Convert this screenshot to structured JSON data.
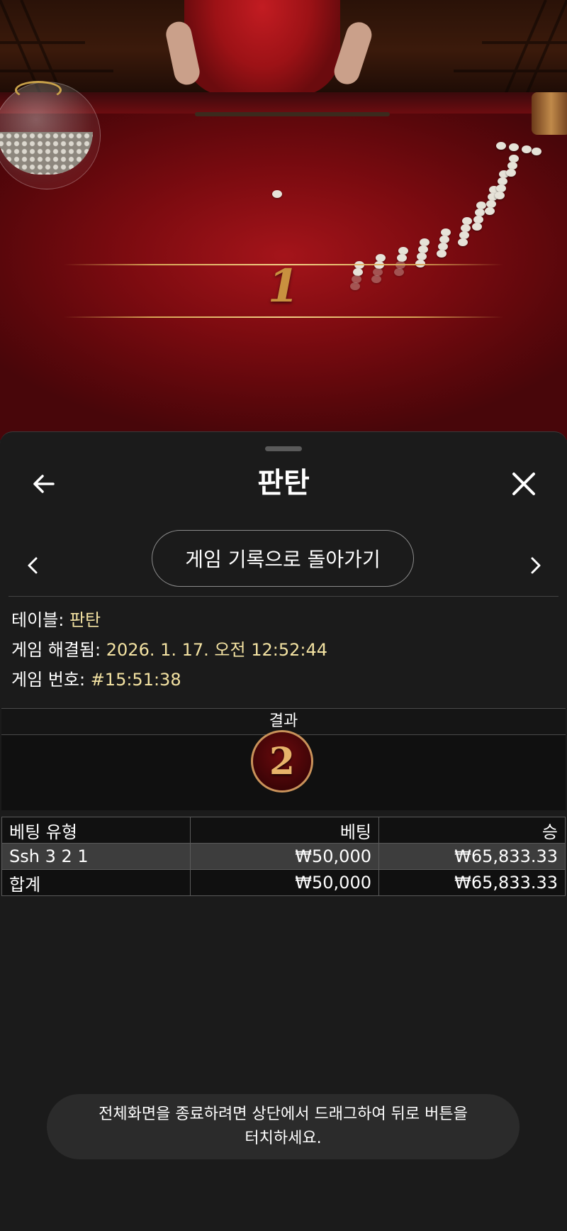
{
  "video": {
    "zone_number": "1"
  },
  "sheet": {
    "title": "판탄",
    "back_icon": "arrow-left-icon",
    "close_icon": "close-icon",
    "history_button_label": "게임 기록으로 돌아가기",
    "prev_icon": "chevron-left-icon",
    "next_icon": "chevron-right-icon"
  },
  "info": {
    "table_label": "테이블:",
    "table_value": "판탄",
    "resolved_label": "게임 해결됨:",
    "resolved_value": "2026. 1. 17. 오전 12:52:44",
    "game_number_label": "게임 번호:",
    "game_number_value": "#15:51:38"
  },
  "result": {
    "header": "결과",
    "value": "2"
  },
  "bets_table": {
    "headers": [
      "베팅 유형",
      "베팅",
      "승"
    ],
    "rows": [
      {
        "type": "Ssh 3 2 1",
        "bet": "₩50,000",
        "win": "₩65,833.33"
      }
    ],
    "total": {
      "label": "합계",
      "bet": "₩50,000",
      "win": "₩65,833.33"
    }
  },
  "toast": {
    "line1": "전체화면을 종료하려면 상단에서 드래그하여 뒤로 버튼을",
    "line2": "터치하세요."
  },
  "colors": {
    "accent_gold": "#f3e2a2",
    "felt_red": "#8d0d12",
    "sheet_bg": "#1b1b1b"
  }
}
